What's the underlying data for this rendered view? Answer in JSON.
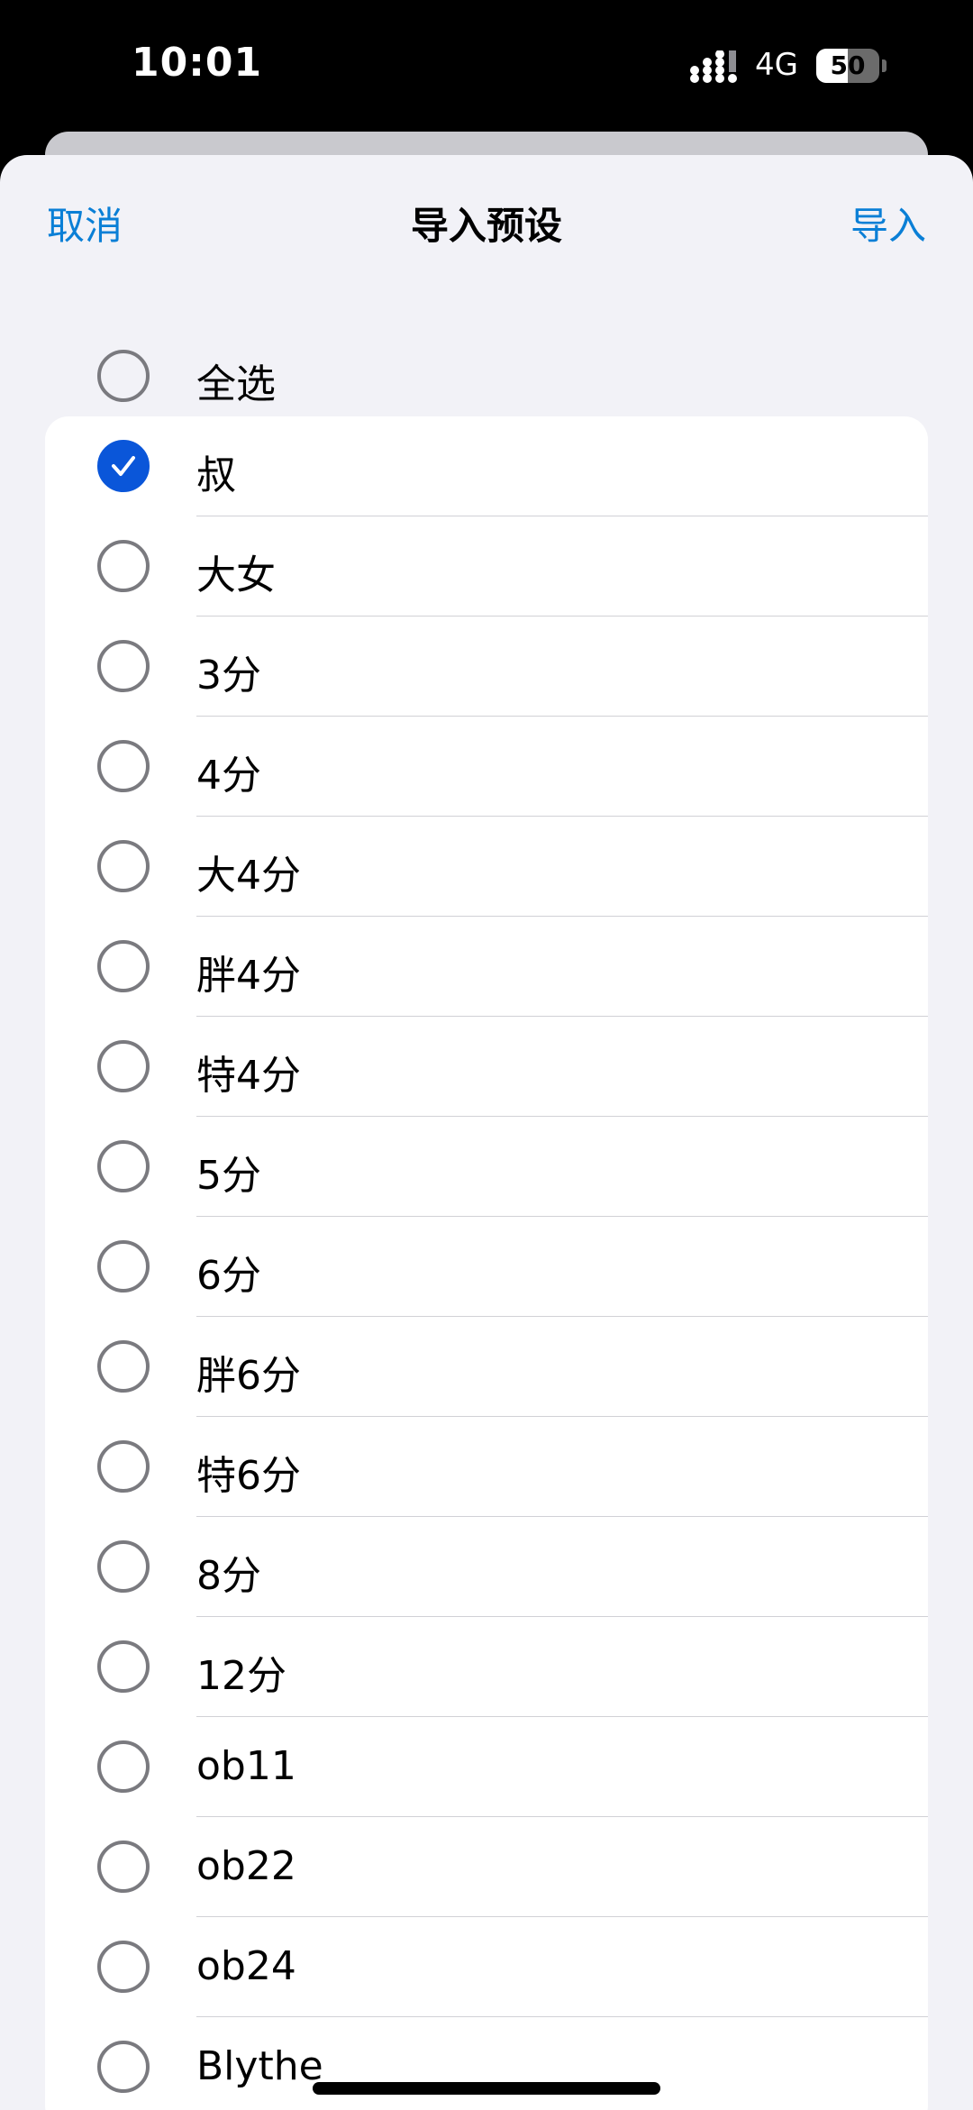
{
  "status": {
    "time": "10:01",
    "network": "4G",
    "battery": "50",
    "battery_level": 0.5
  },
  "nav": {
    "cancel": "取消",
    "title": "导入预设",
    "import": "导入"
  },
  "select_all": {
    "label": "全选",
    "checked": false
  },
  "items": [
    {
      "label": "叔",
      "checked": true
    },
    {
      "label": "大女",
      "checked": false
    },
    {
      "label": "3分",
      "checked": false
    },
    {
      "label": "4分",
      "checked": false
    },
    {
      "label": "大4分",
      "checked": false
    },
    {
      "label": "胖4分",
      "checked": false
    },
    {
      "label": "特4分",
      "checked": false
    },
    {
      "label": "5分",
      "checked": false
    },
    {
      "label": "6分",
      "checked": false
    },
    {
      "label": "胖6分",
      "checked": false
    },
    {
      "label": "特6分",
      "checked": false
    },
    {
      "label": "8分",
      "checked": false
    },
    {
      "label": "12分",
      "checked": false
    },
    {
      "label": "ob11",
      "checked": false
    },
    {
      "label": "ob22",
      "checked": false
    },
    {
      "label": "ob24",
      "checked": false
    },
    {
      "label": "Blythe",
      "checked": false
    }
  ],
  "colors": {
    "accent": "#0a7fd6",
    "checkbox_selected": "#0a56d9",
    "background": "#f2f2f7"
  }
}
